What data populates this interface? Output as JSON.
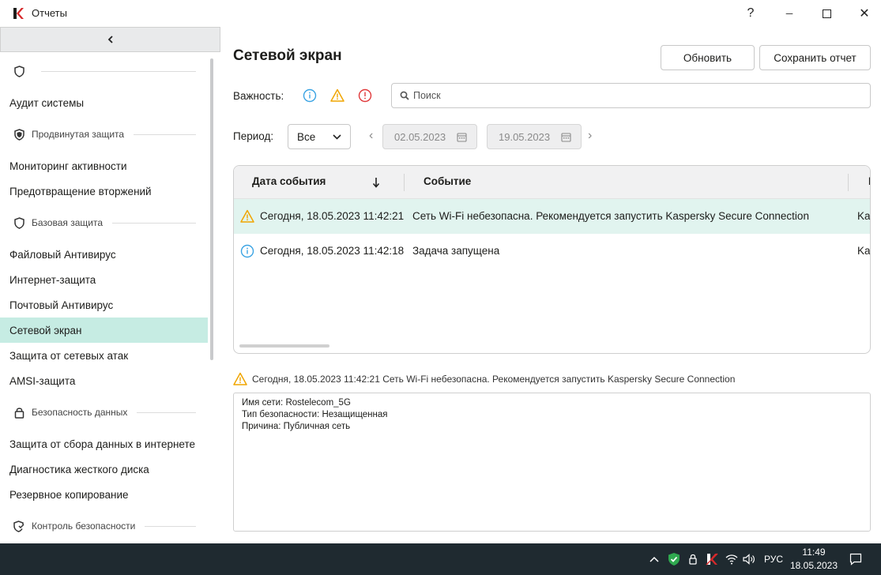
{
  "window": {
    "title": "Отчеты",
    "help": "?",
    "minimize": "─",
    "maximize": "☐",
    "close": "✕"
  },
  "sidebar": {
    "collapse": "‹",
    "items": [
      {
        "label": "Аудит системы"
      },
      {
        "label": "Мониторинг активности"
      },
      {
        "label": "Предотвращение вторжений"
      },
      {
        "label": "Файловый Антивирус"
      },
      {
        "label": "Интернет-защита"
      },
      {
        "label": "Почтовый Антивирус"
      },
      {
        "label": "Сетевой экран"
      },
      {
        "label": "Защита от сетевых атак"
      },
      {
        "label": "AMSI-защита"
      },
      {
        "label": "Защита от сбора данных в интернете"
      },
      {
        "label": "Диагностика жесткого диска"
      },
      {
        "label": "Резервное копирование"
      }
    ],
    "groups": [
      {
        "label": "Продвинутая защита",
        "icon": "shield-icon"
      },
      {
        "label": "Базовая защита",
        "icon": "shield-icon"
      },
      {
        "label": "Безопасность данных",
        "icon": "lock-icon"
      },
      {
        "label": "Контроль безопасности",
        "icon": "shield-check-icon"
      }
    ]
  },
  "main": {
    "title": "Сетевой экран",
    "refresh_label": "Обновить",
    "save_label": "Сохранить отчет",
    "severity_label": "Важность:",
    "search_placeholder": "Поиск",
    "period_label": "Период:",
    "period_value": "Все",
    "date_from": "02.05.2023",
    "date_to": "19.05.2023"
  },
  "table": {
    "columns": [
      "Дата события",
      "Событие"
    ],
    "rows": [
      {
        "severity": "warning",
        "date": "Сегодня, 18.05.2023 11:42:21",
        "event": "Сеть Wi-Fi небезопасна. Рекомендуется запустить Kaspersky Secure Connection",
        "extra": "Kas"
      },
      {
        "severity": "info",
        "date": "Сегодня, 18.05.2023 11:42:18",
        "event": "Задача запущена",
        "extra": "Kas"
      }
    ]
  },
  "details": {
    "header": "Сегодня, 18.05.2023 11:42:21 Сеть Wi-Fi небезопасна. Рекомендуется запустить Kaspersky Secure Connection",
    "lines": [
      "Имя сети: Rostelecom_5G",
      "Тип безопасности: Незащищенная",
      "Причина: Публичная сеть"
    ]
  },
  "taskbar": {
    "lang": "РУС",
    "time": "11:49",
    "date": "18.05.2023"
  },
  "colors": {
    "accent": "#c6ece3",
    "selected_row": "#e1f4ef",
    "info": "#3aa3e3",
    "warning": "#f0a500",
    "error": "#e0383a",
    "taskbar": "#1f2a30",
    "kaspersky_red": "#d7292b",
    "shield_green": "#2fa84f"
  }
}
